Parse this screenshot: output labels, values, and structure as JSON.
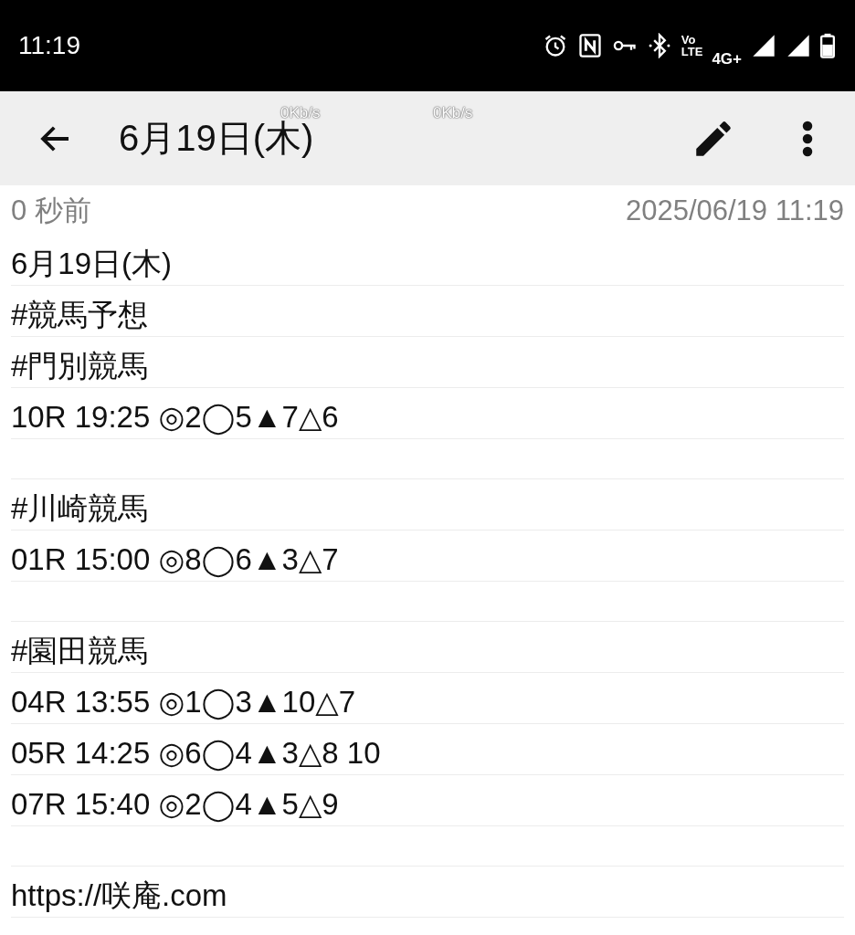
{
  "status_bar": {
    "time": "11:19",
    "volte_top": "Vo",
    "volte_bottom": "LTE",
    "network": "4G+"
  },
  "speed_overlays": [
    "0Kb/s",
    "0Kb/s"
  ],
  "app_bar": {
    "title": "6月19日(木)"
  },
  "meta": {
    "relative_time": "0 秒前",
    "timestamp": "2025/06/19 11:19"
  },
  "note_blocks": [
    [
      "6月19日(木)",
      "#競馬予想",
      "#門別競馬",
      "10R 19:25 ◎2◯5▲7△6"
    ],
    [
      "#川崎競馬",
      "01R 15:00 ◎8◯6▲3△7"
    ],
    [
      "#園田競馬",
      "04R 13:55 ◎1◯3▲10△7",
      "05R 14:25 ◎6◯4▲3△8 10",
      "07R 15:40 ◎2◯4▲5△9"
    ],
    [
      "https://咲庵.com"
    ]
  ]
}
